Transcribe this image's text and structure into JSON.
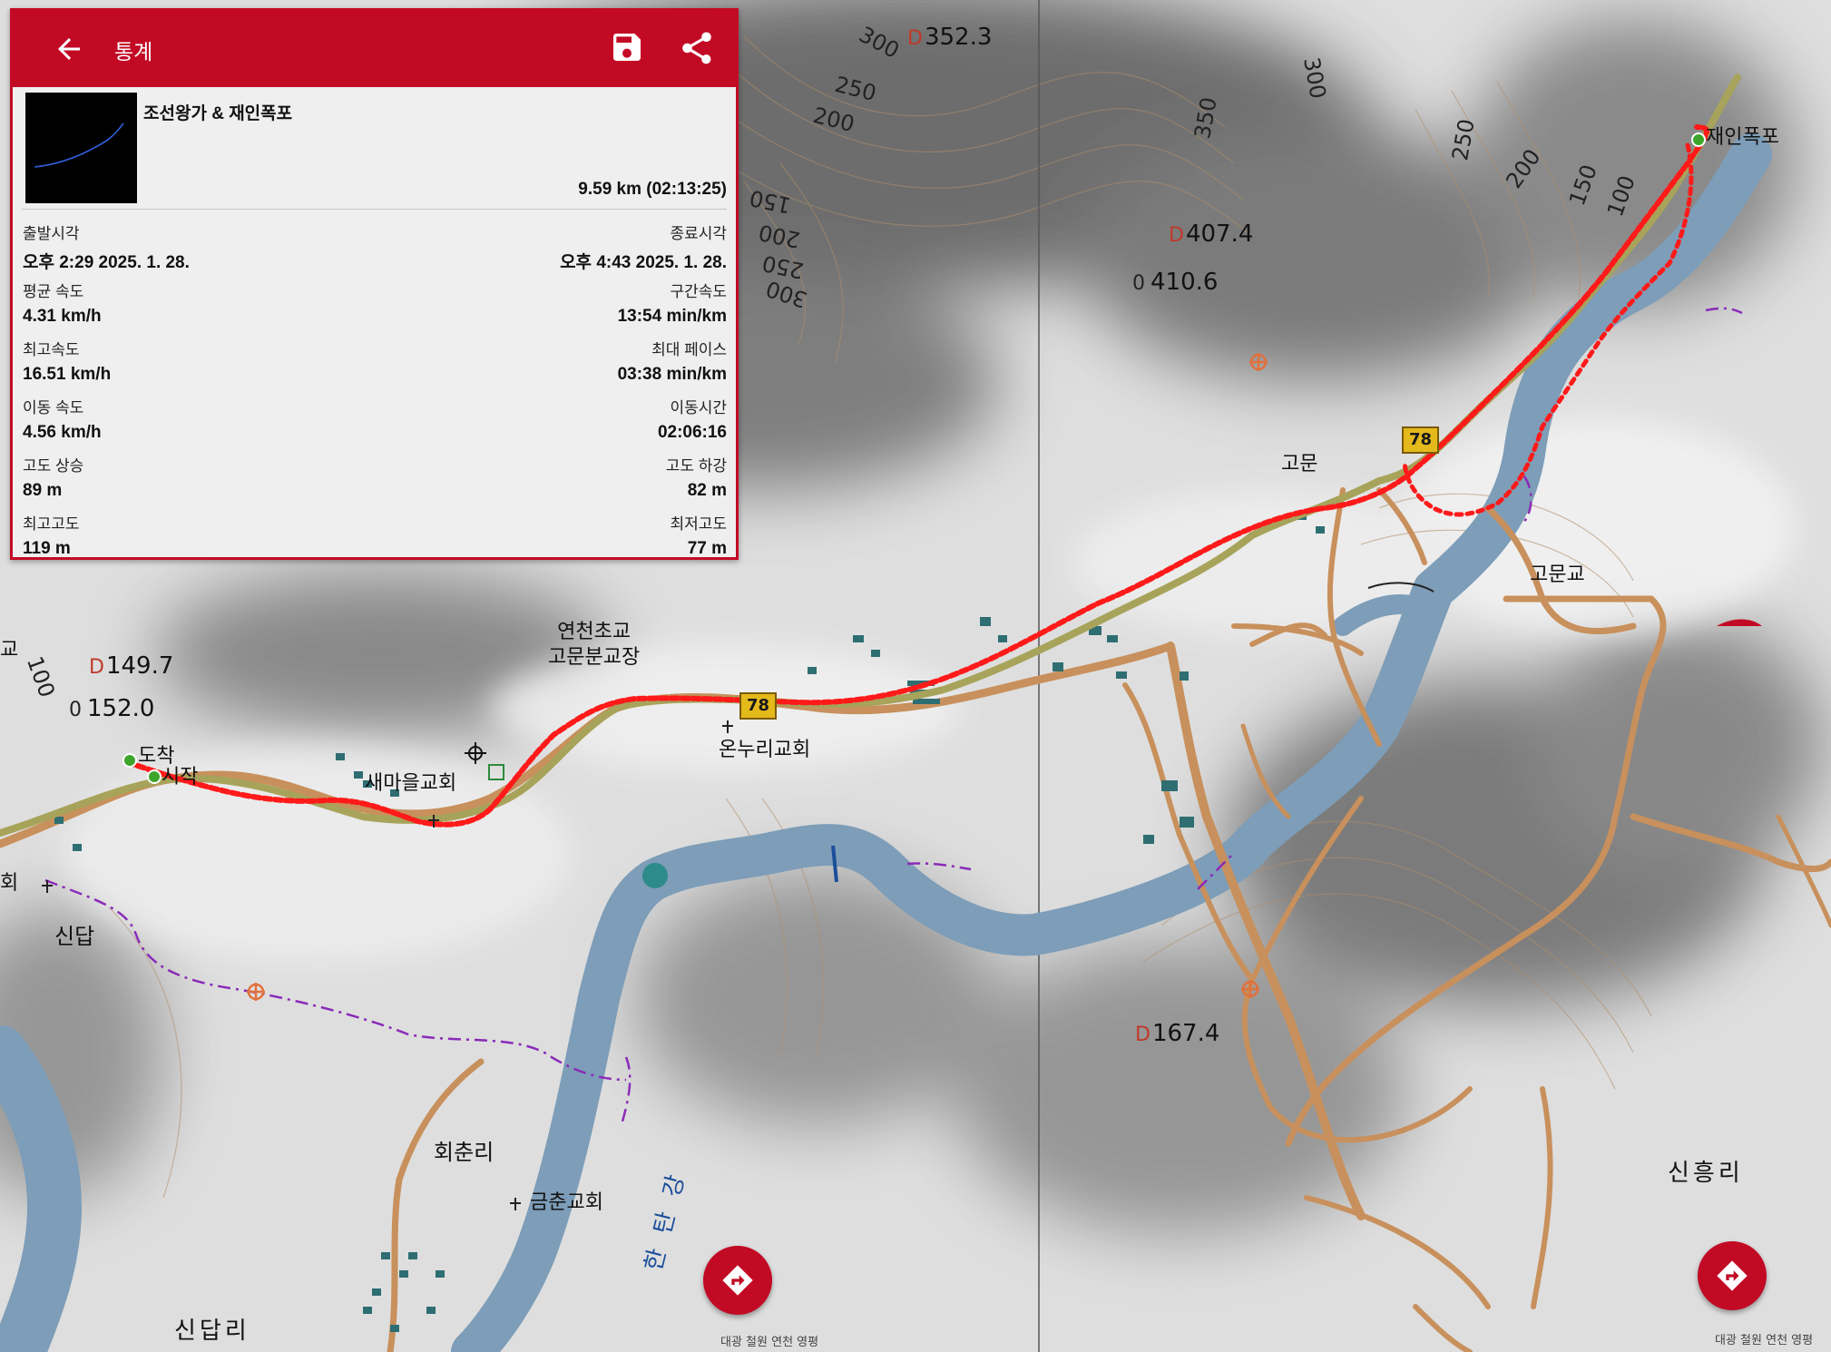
{
  "header": {
    "back_icon": "arrow-back-icon",
    "title": "통계",
    "save_icon": "save-icon",
    "share_icon": "share-icon"
  },
  "track": {
    "name": "조선왕가 & 재인폭포",
    "distance": "9.59 km (02:13:25)"
  },
  "stats": [
    {
      "left": {
        "label": "출발시각",
        "value": "오후 2:29 2025. 1. 28."
      },
      "right": {
        "label": "종료시각",
        "value": "오후 4:43 2025. 1. 28."
      }
    },
    {
      "left": {
        "label": "평균 속도",
        "value": "4.31 km/h"
      },
      "right": {
        "label": "구간속도",
        "value": "13:54 min/km"
      }
    },
    {
      "left": {
        "label": "최고속도",
        "value": "16.51 km/h"
      },
      "right": {
        "label": "최대 페이스",
        "value": "03:38 min/km"
      }
    },
    {
      "left": {
        "label": "이동 속도",
        "value": "4.56 km/h"
      },
      "right": {
        "label": "이동시간",
        "value": "02:06:16"
      }
    },
    {
      "left": {
        "label": "고도 상승",
        "value": "89 m"
      },
      "right": {
        "label": "고도 하강",
        "value": "82 m"
      }
    },
    {
      "left": {
        "label": "최고고도",
        "value": "119 m"
      },
      "right": {
        "label": "최저고도",
        "value": "77 m"
      }
    }
  ],
  "map": {
    "places": {
      "jaein_falls": "재인폭포",
      "gomun": "고문",
      "gomun_bridge": "고문교",
      "school": "연천초교\n고문분교장",
      "onnuri_church": "온누리교회",
      "saemaeul_church": "새마을교회",
      "arrival": "도착",
      "start": "시작",
      "sindap": "신답",
      "hoechun": "회춘리",
      "geumchun_church": "금춘교회",
      "sindap_ri": "신답리",
      "sinheung_ri": "신흥리",
      "hantan_river": "한탄강",
      "edge_left_1": "교",
      "edge_left_2": "회"
    },
    "elevations": {
      "e352": "352.3",
      "e407": "407.4",
      "e410": "410.6",
      "e149": "149.7",
      "e152": "152.0",
      "e167": "167.4"
    },
    "contours": [
      "300",
      "250",
      "200",
      "300",
      "350",
      "250",
      "200",
      "150",
      "100",
      "150",
      "200",
      "250",
      "300",
      "100"
    ],
    "road_number": "78",
    "copyright": "대광 철원 연천 영평",
    "colors": {
      "accent": "#c20a25",
      "track": "#ff1a1a",
      "road": "#c8905c",
      "water": "#7d9db8"
    }
  },
  "fab_icon": "directions-icon"
}
